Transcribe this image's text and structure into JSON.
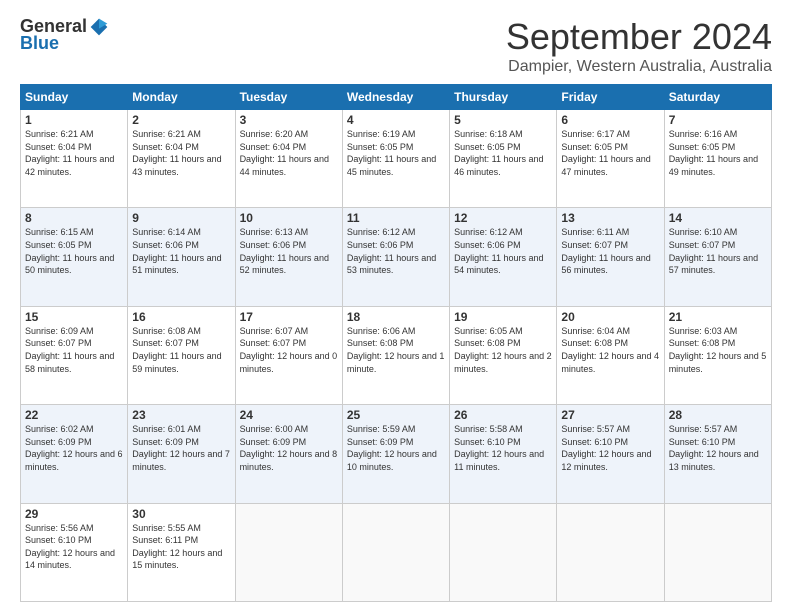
{
  "logo": {
    "general": "General",
    "blue": "Blue"
  },
  "title": "September 2024",
  "location": "Dampier, Western Australia, Australia",
  "days_of_week": [
    "Sunday",
    "Monday",
    "Tuesday",
    "Wednesday",
    "Thursday",
    "Friday",
    "Saturday"
  ],
  "weeks": [
    [
      {
        "day": "1",
        "sunrise": "6:21 AM",
        "sunset": "6:04 PM",
        "daylight": "11 hours and 42 minutes."
      },
      {
        "day": "2",
        "sunrise": "6:21 AM",
        "sunset": "6:04 PM",
        "daylight": "11 hours and 43 minutes."
      },
      {
        "day": "3",
        "sunrise": "6:20 AM",
        "sunset": "6:04 PM",
        "daylight": "11 hours and 44 minutes."
      },
      {
        "day": "4",
        "sunrise": "6:19 AM",
        "sunset": "6:05 PM",
        "daylight": "11 hours and 45 minutes."
      },
      {
        "day": "5",
        "sunrise": "6:18 AM",
        "sunset": "6:05 PM",
        "daylight": "11 hours and 46 minutes."
      },
      {
        "day": "6",
        "sunrise": "6:17 AM",
        "sunset": "6:05 PM",
        "daylight": "11 hours and 47 minutes."
      },
      {
        "day": "7",
        "sunrise": "6:16 AM",
        "sunset": "6:05 PM",
        "daylight": "11 hours and 49 minutes."
      }
    ],
    [
      {
        "day": "8",
        "sunrise": "6:15 AM",
        "sunset": "6:05 PM",
        "daylight": "11 hours and 50 minutes."
      },
      {
        "day": "9",
        "sunrise": "6:14 AM",
        "sunset": "6:06 PM",
        "daylight": "11 hours and 51 minutes."
      },
      {
        "day": "10",
        "sunrise": "6:13 AM",
        "sunset": "6:06 PM",
        "daylight": "11 hours and 52 minutes."
      },
      {
        "day": "11",
        "sunrise": "6:12 AM",
        "sunset": "6:06 PM",
        "daylight": "11 hours and 53 minutes."
      },
      {
        "day": "12",
        "sunrise": "6:12 AM",
        "sunset": "6:06 PM",
        "daylight": "11 hours and 54 minutes."
      },
      {
        "day": "13",
        "sunrise": "6:11 AM",
        "sunset": "6:07 PM",
        "daylight": "11 hours and 56 minutes."
      },
      {
        "day": "14",
        "sunrise": "6:10 AM",
        "sunset": "6:07 PM",
        "daylight": "11 hours and 57 minutes."
      }
    ],
    [
      {
        "day": "15",
        "sunrise": "6:09 AM",
        "sunset": "6:07 PM",
        "daylight": "11 hours and 58 minutes."
      },
      {
        "day": "16",
        "sunrise": "6:08 AM",
        "sunset": "6:07 PM",
        "daylight": "11 hours and 59 minutes."
      },
      {
        "day": "17",
        "sunrise": "6:07 AM",
        "sunset": "6:07 PM",
        "daylight": "12 hours and 0 minutes."
      },
      {
        "day": "18",
        "sunrise": "6:06 AM",
        "sunset": "6:08 PM",
        "daylight": "12 hours and 1 minute."
      },
      {
        "day": "19",
        "sunrise": "6:05 AM",
        "sunset": "6:08 PM",
        "daylight": "12 hours and 2 minutes."
      },
      {
        "day": "20",
        "sunrise": "6:04 AM",
        "sunset": "6:08 PM",
        "daylight": "12 hours and 4 minutes."
      },
      {
        "day": "21",
        "sunrise": "6:03 AM",
        "sunset": "6:08 PM",
        "daylight": "12 hours and 5 minutes."
      }
    ],
    [
      {
        "day": "22",
        "sunrise": "6:02 AM",
        "sunset": "6:09 PM",
        "daylight": "12 hours and 6 minutes."
      },
      {
        "day": "23",
        "sunrise": "6:01 AM",
        "sunset": "6:09 PM",
        "daylight": "12 hours and 7 minutes."
      },
      {
        "day": "24",
        "sunrise": "6:00 AM",
        "sunset": "6:09 PM",
        "daylight": "12 hours and 8 minutes."
      },
      {
        "day": "25",
        "sunrise": "5:59 AM",
        "sunset": "6:09 PM",
        "daylight": "12 hours and 10 minutes."
      },
      {
        "day": "26",
        "sunrise": "5:58 AM",
        "sunset": "6:10 PM",
        "daylight": "12 hours and 11 minutes."
      },
      {
        "day": "27",
        "sunrise": "5:57 AM",
        "sunset": "6:10 PM",
        "daylight": "12 hours and 12 minutes."
      },
      {
        "day": "28",
        "sunrise": "5:57 AM",
        "sunset": "6:10 PM",
        "daylight": "12 hours and 13 minutes."
      }
    ],
    [
      {
        "day": "29",
        "sunrise": "5:56 AM",
        "sunset": "6:10 PM",
        "daylight": "12 hours and 14 minutes."
      },
      {
        "day": "30",
        "sunrise": "5:55 AM",
        "sunset": "6:11 PM",
        "daylight": "12 hours and 15 minutes."
      },
      null,
      null,
      null,
      null,
      null
    ]
  ]
}
